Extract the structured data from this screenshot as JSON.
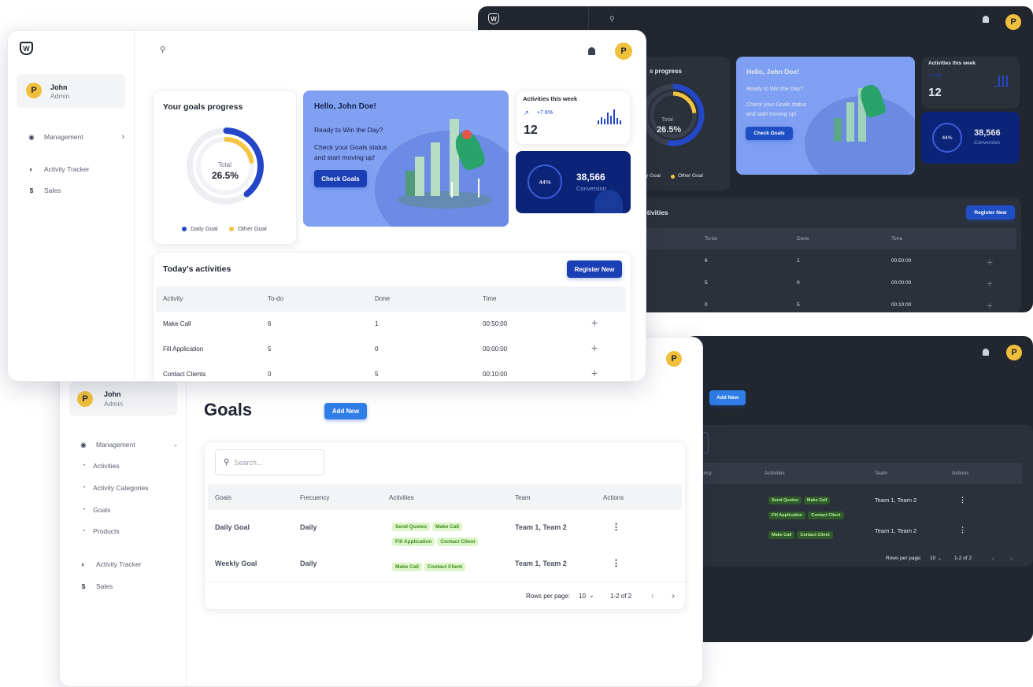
{
  "brand": {
    "logo_letter": "W"
  },
  "user": {
    "initial": "P",
    "name": "John",
    "role": "Admin"
  },
  "nav": {
    "management": "Management",
    "activities": "Activities",
    "activity_categories": "Activity Categories",
    "goals": "Goals",
    "products": "Products",
    "activity_tracker": "Activity Tracker",
    "sales": "Sales"
  },
  "progress": {
    "title": "Your goals progress",
    "total_label": "Total",
    "total_value": "26.5%",
    "legend_daily": "Daily Goal",
    "legend_other": "Other Goal",
    "title_partial": "s progress",
    "legend_daily_partial": "y Goal",
    "daily_color": "#2446c8",
    "other_color": "#f4c542"
  },
  "hero": {
    "greeting": "Hello, John Doe!",
    "line1": "Ready to Win the Day?",
    "line2": "Check your Goals status",
    "line3": "and start moving up!",
    "button": "Check Goals"
  },
  "weekly": {
    "title": "Activities this week",
    "trend": "+7.6%",
    "count": "12"
  },
  "conversion": {
    "percent": "44%",
    "value": "38,566",
    "label": "Conversion"
  },
  "activities": {
    "title": "Today's activities",
    "title_partial": "ctivities",
    "register_button": "Register New",
    "headers": [
      "Activity",
      "To-do",
      "Done",
      "Time"
    ],
    "rows": [
      {
        "activity": "Make Call",
        "todo": "6",
        "done": "1",
        "time": "00:50:00"
      },
      {
        "activity": "Fill Application",
        "todo": "5",
        "done": "0",
        "time": "00:00:00"
      },
      {
        "activity": "Contact Clients",
        "todo": "0",
        "done": "5",
        "time": "00:10:00"
      }
    ],
    "dark_partial_cells": [
      "n",
      "ts"
    ]
  },
  "goals_page": {
    "title": "Goals",
    "add_button": "Add New",
    "search_placeholder": "Search...",
    "headers": [
      "Goals",
      "Frecuency",
      "Activities",
      "Team",
      "Actions"
    ],
    "headers_partial_frequency": "ency",
    "rows": [
      {
        "goal": "Daily Goal",
        "frequency": "Daily",
        "activities": [
          "Send Quotes",
          "Make Call",
          "Fill Application",
          "Contact Client"
        ],
        "team": "Team 1, Team 2"
      },
      {
        "goal": "Weekly Goal",
        "frequency": "Daily",
        "activities": [
          "Make Call",
          "Contact Client"
        ],
        "team": "Team 1, Team 2"
      }
    ],
    "pagination": {
      "rows_per_page_label": "Rows per page:",
      "rows_per_page": "10",
      "range": "1-2 of 2"
    }
  }
}
